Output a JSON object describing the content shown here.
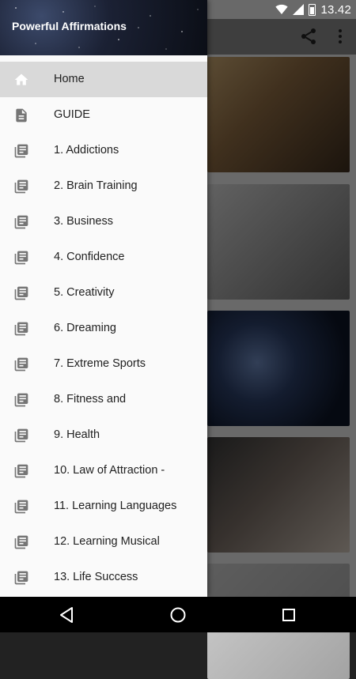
{
  "status_bar": {
    "time": "13.42",
    "battery_level": "charging"
  },
  "app": {
    "title": "Powerful Affirmations",
    "toolbar_icons": [
      "share-icon",
      "more-vert-icon"
    ]
  },
  "drawer": {
    "items": [
      {
        "label": "Home",
        "icon": "home-icon",
        "active": true
      },
      {
        "label": "GUIDE",
        "icon": "document-icon",
        "active": false
      },
      {
        "label": "1. Addictions",
        "icon": "article-icon",
        "active": false
      },
      {
        "label": "2. Brain Training",
        "icon": "article-icon",
        "active": false
      },
      {
        "label": "3. Business",
        "icon": "article-icon",
        "active": false
      },
      {
        "label": "4. Confidence",
        "icon": "article-icon",
        "active": false
      },
      {
        "label": "5. Creativity",
        "icon": "article-icon",
        "active": false
      },
      {
        "label": "6. Dreaming",
        "icon": "article-icon",
        "active": false
      },
      {
        "label": "7. Extreme Sports",
        "icon": "article-icon",
        "active": false
      },
      {
        "label": "8. Fitness and",
        "icon": "article-icon",
        "active": false
      },
      {
        "label": "9. Health",
        "icon": "article-icon",
        "active": false
      },
      {
        "label": "10. Law of Attraction -",
        "icon": "article-icon",
        "active": false
      },
      {
        "label": "11. Learning Languages",
        "icon": "article-icon",
        "active": false
      },
      {
        "label": "12. Learning Musical",
        "icon": "article-icon",
        "active": false
      },
      {
        "label": "13. Life Success",
        "icon": "article-icon",
        "active": false
      }
    ]
  },
  "nav_bar": {
    "buttons": [
      "back-icon",
      "home-circle-icon",
      "recents-icon"
    ]
  },
  "colors": {
    "drawer_bg": "#fafafa",
    "active_item_bg": "#d9d9d9",
    "icon_gray": "#757575",
    "text": "#212121"
  }
}
